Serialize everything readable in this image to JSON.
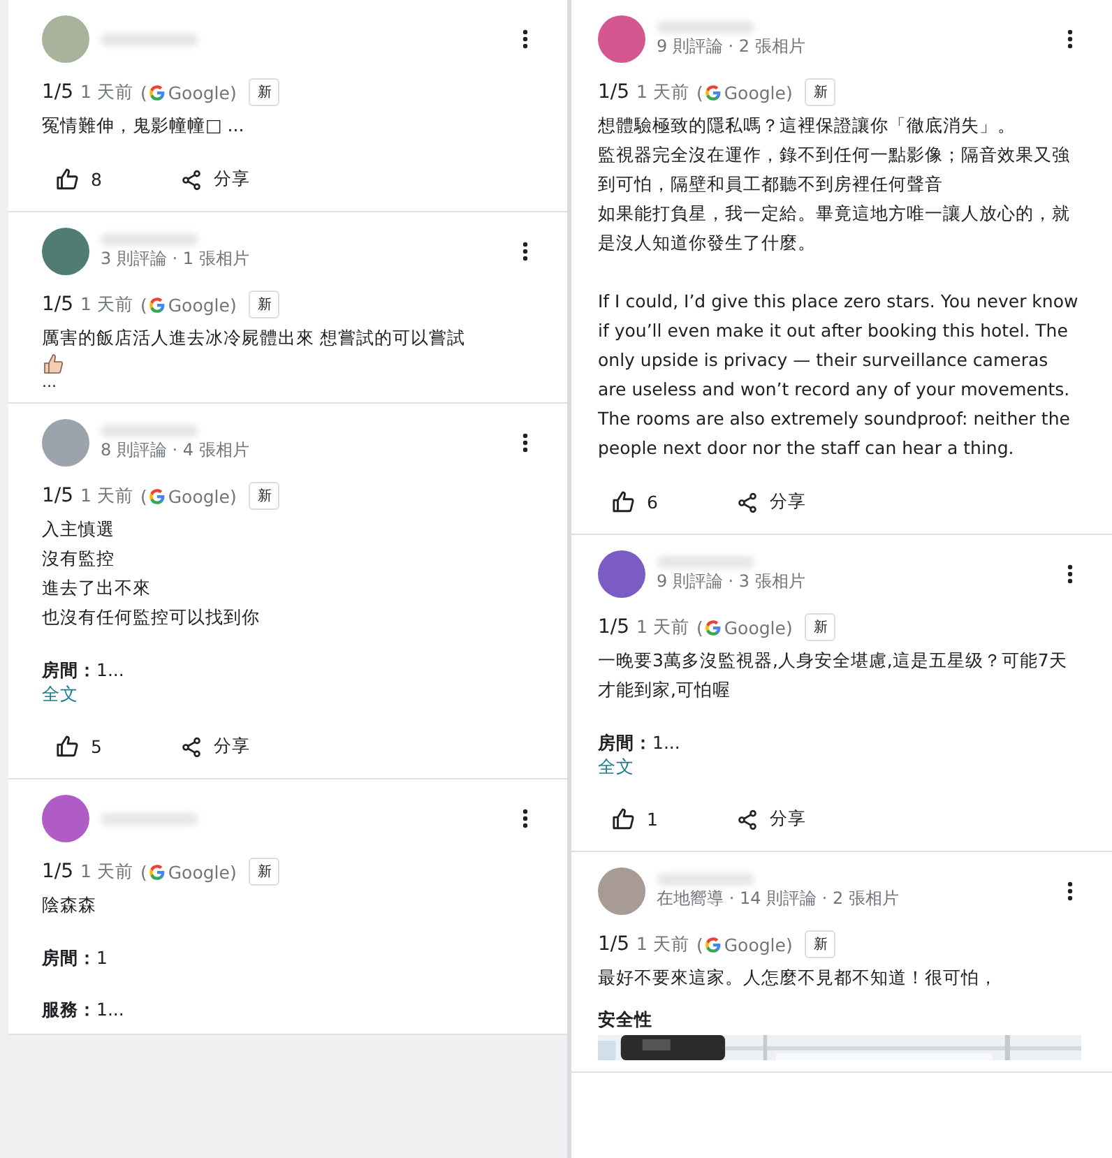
{
  "columns": [
    {
      "reviews": [
        {
          "avatar": {
            "color": "#a9b39c"
          },
          "rating": "1/5",
          "time": "1 天前",
          "source_open": "(",
          "source": "Google)",
          "badge": "新",
          "text": [
            [
              "冤情難伸，鬼影幢幢□ ..."
            ]
          ],
          "likes": "8",
          "share": "分享"
        },
        {
          "avatar": {
            "color": "#4f7d74"
          },
          "meta": "3 則評論 · 1 張相片",
          "rating": "1/5",
          "time": "1 天前",
          "source_open": "(",
          "source": "Google)",
          "badge": "新",
          "text": [
            [
              "厲害的飯店活人進去冰冷屍體出來 想嘗試的可以嘗試"
            ]
          ],
          "thumb_emoji": true,
          "more_text": "..."
        },
        {
          "avatar": {
            "color": "#9ba4ad"
          },
          "meta": "8 則評論 · 4 張相片",
          "rating": "1/5",
          "time": "1 天前",
          "source_open": "(",
          "source": "Google)",
          "badge": "新",
          "text": [
            [
              "入主慎選",
              "沒有監控",
              "進去了出不來",
              "也沒有任何監控可以找到你"
            ]
          ],
          "details": [
            "**房間：**1..."
          ],
          "more_link": "全文",
          "likes": "5",
          "share": "分享"
        },
        {
          "avatar": {
            "color": "#b05cc7"
          },
          "rating": "1/5",
          "time": "1 天前",
          "source_open": "(",
          "source": "Google)",
          "badge": "新",
          "text": [
            [
              "陰森森"
            ]
          ],
          "details": [
            "**房間：**1",
            "**服務：**1..."
          ]
        }
      ]
    },
    {
      "reviews": [
        {
          "avatar": {
            "color": "#d4588f"
          },
          "meta": "9 則評論 · 2 張相片",
          "rating": "1/5",
          "time": "1 天前",
          "source_open": "(",
          "source": "Google)",
          "badge": "新",
          "text": [
            [
              "想體驗極致的隱私嗎？這裡保證讓你「徹底消失」。",
              "監視器完全沒在運作，錄不到任何一點影像；隔音效果又強到可怕，隔壁和員工都聽不到房裡任何聲音",
              "如果能打負星，我一定給。畢竟這地方唯一讓人放心的，就是沒人知道你發生了什麼。"
            ],
            [
              "If I could, I’d give this place zero stars. You never know if you’ll even make it out after booking this hotel. The only upside is privacy — their surveillance cameras are useless and won’t record any of your movements. The rooms are also extremely soundproof: neither the people next door nor the staff can hear a thing."
            ]
          ],
          "likes": "6",
          "share": "分享"
        },
        {
          "avatar": {
            "color": "#7b5cc4"
          },
          "meta": "9 則評論 · 3 張相片",
          "rating": "1/5",
          "time": "1 天前",
          "source_open": "(",
          "source": "Google)",
          "badge": "新",
          "text": [
            [
              "一晚要3萬多沒監視器,人身安全堪慮,這是五星级？可能7天才能到家,可怕喔"
            ]
          ],
          "details": [
            "**房間：**1..."
          ],
          "more_link": "全文",
          "likes": "1",
          "share": "分享"
        },
        {
          "avatar": {
            "color": "#a89a94"
          },
          "meta": "在地嚮導 · 14 則評論 · 2 張相片",
          "rating": "1/5",
          "time": "1 天前",
          "source_open": "(",
          "source": "Google)",
          "badge": "新",
          "text": [
            [
              "最好不要來這家。人怎麼不見都不知道！很可怕，"
            ]
          ],
          "section_heading": "安全性",
          "map_preview": {
            "kind": "picture"
          }
        }
      ]
    }
  ]
}
